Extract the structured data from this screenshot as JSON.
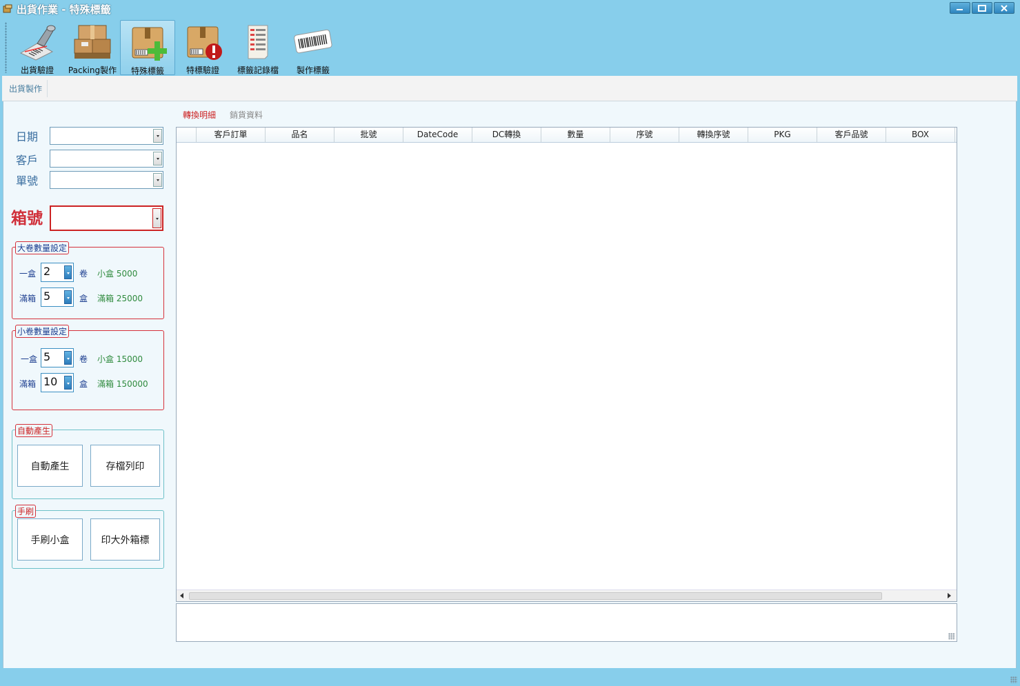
{
  "window": {
    "title": "出貨作業 - 特殊標籤"
  },
  "ribbon": {
    "buttons": [
      {
        "label": "出貨驗證",
        "icon": "barcode-scanner-icon"
      },
      {
        "label": "Packing製作",
        "icon": "cardboard-boxes-icon"
      },
      {
        "label": "特殊標籤",
        "icon": "box-add-icon"
      },
      {
        "label": "特標驗證",
        "icon": "box-alert-icon"
      },
      {
        "label": "標籤記錄檔",
        "icon": "label-log-icon"
      },
      {
        "label": "製作標籤",
        "icon": "barcode-label-icon"
      }
    ],
    "active_index": 2
  },
  "tabs": {
    "main_tab": "出貨製作"
  },
  "form": {
    "date_label": "日期",
    "customer_label": "客戶",
    "order_label": "單號",
    "box_label": "箱號",
    "date_value": "",
    "customer_value": "",
    "order_value": "",
    "box_value": ""
  },
  "large_roll": {
    "title": "大卷數量設定",
    "row1": {
      "label": "一盒",
      "value": "2",
      "unit": "卷",
      "info": "小盒 5000"
    },
    "row2": {
      "label": "滿箱",
      "value": "5",
      "unit": "盒",
      "info": "滿箱 25000"
    }
  },
  "small_roll": {
    "title": "小卷數量設定",
    "row1": {
      "label": "一盒",
      "value": "5",
      "unit": "卷",
      "info": "小盒 15000"
    },
    "row2": {
      "label": "滿箱",
      "value": "10",
      "unit": "盒",
      "info": "滿箱 150000"
    }
  },
  "auto_group": {
    "title": "自動產生",
    "btn_auto": "自動產生",
    "btn_save_print": "存檔列印"
  },
  "manual_group": {
    "title": "手刷",
    "btn_small_box": "手刷小盒",
    "btn_outer_label": "印大外箱標"
  },
  "subtabs": {
    "active": "轉換明細",
    "inactive": "銷貨資料"
  },
  "grid": {
    "columns": [
      "客戶訂單",
      "品名",
      "批號",
      "DateCode",
      "DC轉換",
      "數量",
      "序號",
      "轉換序號",
      "PKG",
      "客戶品號",
      "BOX"
    ]
  },
  "colors": {
    "chrome": "#87CEEB",
    "accent_red": "#d0303a",
    "label_blue": "#1b3d8f",
    "info_green": "#2e8a3d"
  }
}
